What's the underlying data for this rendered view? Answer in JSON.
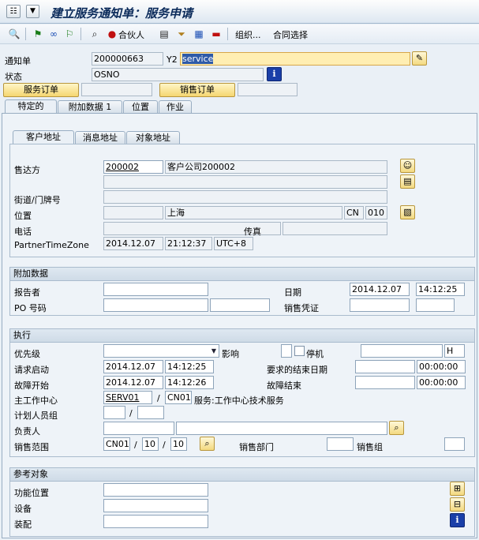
{
  "title": "建立服务通知单：服务申请",
  "toolbar": {
    "partner_label": "合伙人",
    "org_label": "组织...",
    "contract_label": "合同选择"
  },
  "header": {
    "notification_label": "通知单",
    "notification_number": "200000663",
    "notification_type": "Y2",
    "description": "service",
    "status_label": "状态",
    "status_value": "OSNO",
    "service_order_button": "服务订单",
    "sales_order_button": "销售订单"
  },
  "tabs": [
    "特定的",
    "附加数据 1",
    "位置",
    "作业"
  ],
  "subtabs": [
    "客户地址",
    "消息地址",
    "对象地址"
  ],
  "customer": {
    "sold_to_label": "售达方",
    "sold_to_number": "200002",
    "sold_to_name": "客户公司200002",
    "street_label": "街道/门牌号",
    "location_label": "位置",
    "city": "上海",
    "country": "CN",
    "region": "010",
    "phone_label": "电话",
    "fax_label": "传真",
    "timezone_label": "PartnerTimeZone",
    "tz_date": "2014.12.07",
    "tz_time": "21:12:37",
    "tz_zone": "UTC+8"
  },
  "additional": {
    "section_title": "附加数据",
    "reporter_label": "报告者",
    "date_label": "日期",
    "date_value": "2014.12.07",
    "time_value": "14:12:25",
    "po_label": "PO 号码",
    "sales_doc_label": "销售凭证"
  },
  "execution": {
    "section_title": "执行",
    "priority_label": "优先级",
    "impact_label": "影响",
    "shutdown_label": "停机",
    "unit_value": "H",
    "req_start_label": "请求启动",
    "req_start_date": "2014.12.07",
    "req_start_time": "14:12:25",
    "req_end_label": "要求的结束日期",
    "req_end_time": "00:00:00",
    "malf_start_label": "故障开始",
    "malf_start_date": "2014.12.07",
    "malf_start_time": "14:12:26",
    "malf_end_label": "故障结束",
    "malf_end_time": "00:00:00",
    "workcenter_label": "主工作中心",
    "workcenter_value": "SERV01",
    "plant_value": "CN01",
    "workcenter_desc": "服务:工作中心技术服务",
    "planner_group_label": "计划人员组",
    "responsible_label": "负责人",
    "sales_area_label": "销售范围",
    "sales_org": "CN01",
    "dist_channel": "10",
    "division": "10",
    "sales_office_label": "销售部门",
    "sales_group_label": "销售组"
  },
  "reference": {
    "section_title": "参考对象",
    "func_loc_label": "功能位置",
    "equipment_label": "设备",
    "assembly_label": "装配"
  }
}
